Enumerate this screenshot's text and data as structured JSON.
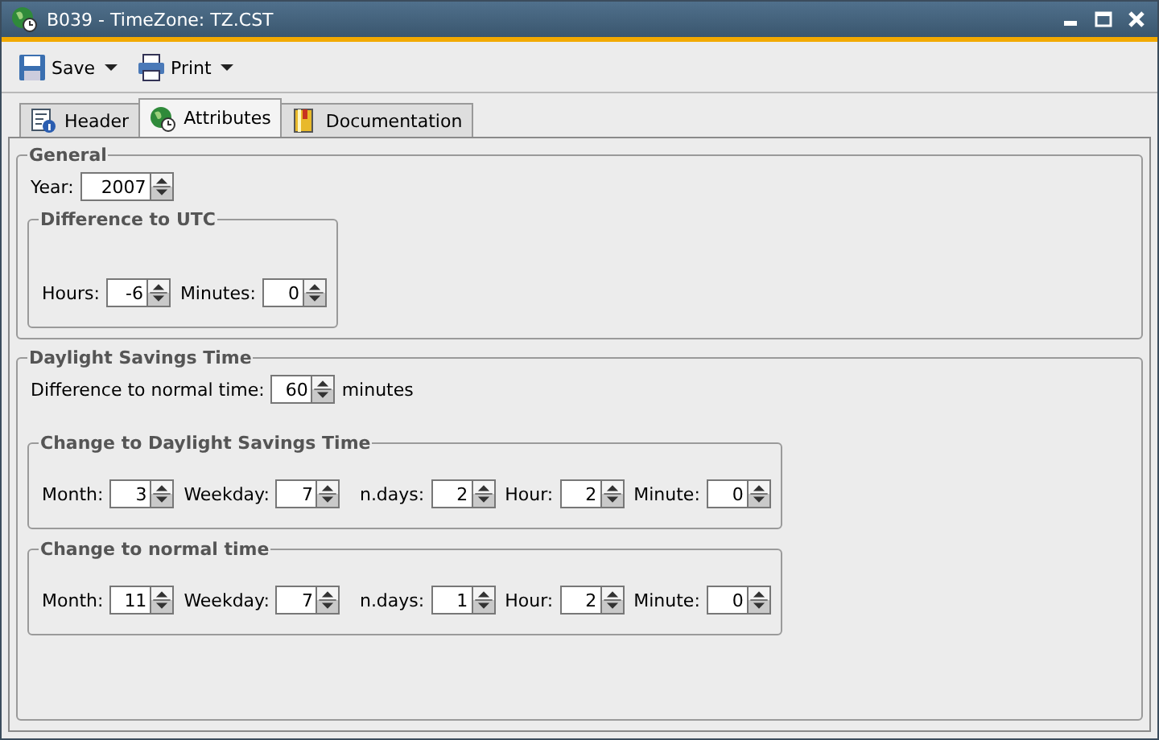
{
  "window": {
    "title": "B039 - TimeZone: TZ.CST"
  },
  "toolbar": [
    {
      "kind": "save",
      "label": "Save"
    },
    {
      "kind": "print",
      "label": "Print"
    }
  ],
  "tabs": [
    {
      "kind": "info",
      "label": "Header",
      "selected": false
    },
    {
      "kind": "globe",
      "label": "Attributes",
      "selected": true
    },
    {
      "kind": "book",
      "label": "Documentation",
      "selected": false
    }
  ],
  "general": {
    "title": "General",
    "year": {
      "label": "Year:",
      "value": "2007"
    },
    "utc": {
      "title": "Difference to UTC",
      "fields": [
        {
          "label": "Hours:",
          "value": "-6"
        },
        {
          "label": "Minutes:",
          "value": "0"
        }
      ]
    }
  },
  "dst": {
    "title": "Daylight Savings Time",
    "difference": {
      "label": "Difference to normal time:",
      "value": "60",
      "unit": "minutes"
    },
    "groups": [
      {
        "title": "Change to Daylight Savings Time",
        "fields": [
          {
            "label": "Month:",
            "value": "3"
          },
          {
            "label": "Weekday:",
            "value": "7"
          },
          {
            "label": "n.days:",
            "value": "2"
          },
          {
            "label": "Hour:",
            "value": "2"
          },
          {
            "label": "Minute:",
            "value": "0"
          }
        ]
      },
      {
        "title": "Change to normal time",
        "fields": [
          {
            "label": "Month:",
            "value": "11"
          },
          {
            "label": "Weekday:",
            "value": "7"
          },
          {
            "label": "n.days:",
            "value": "1"
          },
          {
            "label": "Hour:",
            "value": "2"
          },
          {
            "label": "Minute:",
            "value": "0"
          }
        ]
      }
    ]
  }
}
